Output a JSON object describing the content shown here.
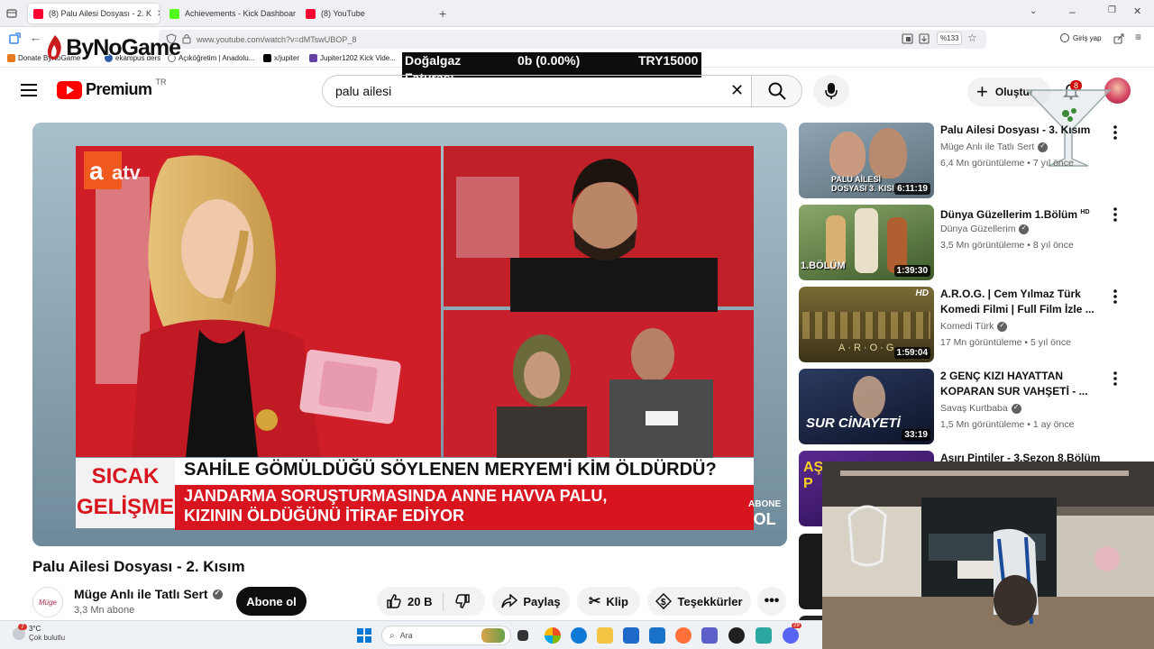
{
  "browser": {
    "tabs": [
      {
        "label": "(8) Palu Ailesi Dosyası - 2. K",
        "active": true
      },
      {
        "label": "Achievements - Kick Dashboard",
        "active": false
      },
      {
        "label": "(8) YouTube",
        "active": false
      }
    ],
    "url": "www.youtube.com/watch?v=dMTswUBOP_8",
    "zoom": "%133",
    "profile_label": "Giriş yap",
    "bookmarks": [
      "Donate ByNoGame",
      "ekampus ders",
      "Açıköğretim | Anadolu...",
      "x/jupiter",
      "Jupiter1202 Kick Vide..."
    ]
  },
  "overlay": {
    "logo_text": "ByNoGame",
    "ticker_left": "Doğalgaz",
    "ticker_left2": "Faturası",
    "ticker_mid": "0b (0.00%)",
    "ticker_right": "TRY15000"
  },
  "youtube": {
    "logo_text": "Premium",
    "logo_region": "TR",
    "search_query": "palu ailesi",
    "create_label": "Oluştur",
    "notification_count": "8"
  },
  "player": {
    "channel_logo": "atv",
    "lower_third_tag1": "SICAK",
    "lower_third_tag2": "GELİŞME",
    "headline": "SAHİLE GÖMÜLDÜĞÜ SÖYLENEN MERYEM'İ KİM ÖLDÜRDÜ?",
    "subline1": "JANDARMA SORUŞTURMASINDA ANNE HAVVA PALU,",
    "subline2": "KIZININ ÖLDÜĞÜNÜ İTİRAF EDİYOR",
    "corner_tag1": "ABONE",
    "corner_tag2": "OL"
  },
  "video": {
    "title": "Palu Ailesi Dosyası - 2. Kısım",
    "channel": "Müge Anlı ile Tatlı Sert",
    "subscribers": "3,3 Mn abone",
    "subscribe_label": "Abone ol",
    "likes": "20 B",
    "share_label": "Paylaş",
    "clip_label": "Klip",
    "thanks_label": "Teşekkürler"
  },
  "recommended": [
    {
      "title": "Palu Ailesi Dosyası - 3. Kısım",
      "channel": "Müge Anlı ile Tatlı Sert",
      "meta": "6,4 Mn görüntüleme • 7 yıl önce",
      "duration": "6:11:19",
      "thumb_text": "PALU AİLESİ DOSYASI 3. KISIM",
      "hd": "",
      "color": "#6b7f8e"
    },
    {
      "title": "Dünya Güzellerim 1.Bölüm",
      "channel": "Dünya Güzellerim",
      "meta": "3,5 Mn görüntüleme • 8 yıl önce",
      "duration": "1:39:30",
      "thumb_text": "1.BÖLÜM",
      "hd": "HD",
      "color": "#5d7a3a"
    },
    {
      "title": "A.R.O.G. | Cem Yılmaz Türk Komedi Filmi | Full Film İzle ...",
      "channel": "Komedi Türk",
      "meta": "17 Mn görüntüleme • 5 yıl önce",
      "duration": "1:59:04",
      "thumb_text": "A·R·O·G",
      "hd": "HD",
      "color": "#6a5a2a"
    },
    {
      "title": "2 GENÇ KIZI HAYATTAN KOPARAN SUR VAHŞETİ - ...",
      "channel": "Savaş Kurtbaba",
      "meta": "1,5 Mn görüntüleme • 1 ay önce",
      "duration": "33:19",
      "thumb_text": "SUR CİNAYETİ",
      "hd": "",
      "color": "#1d2540"
    },
    {
      "title": "Aşırı Pintiler - 3.Sezon 8.Bölüm",
      "channel": "",
      "meta": "",
      "duration": "",
      "thumb_text": "AŞ P",
      "hd": "",
      "color": "#4b1e7a"
    }
  ],
  "taskbar": {
    "weather_temp": "3°C",
    "weather_desc": "Çok bulutlu",
    "weather_badge": "7",
    "search_placeholder": "Ara",
    "discord_badge": "29"
  }
}
